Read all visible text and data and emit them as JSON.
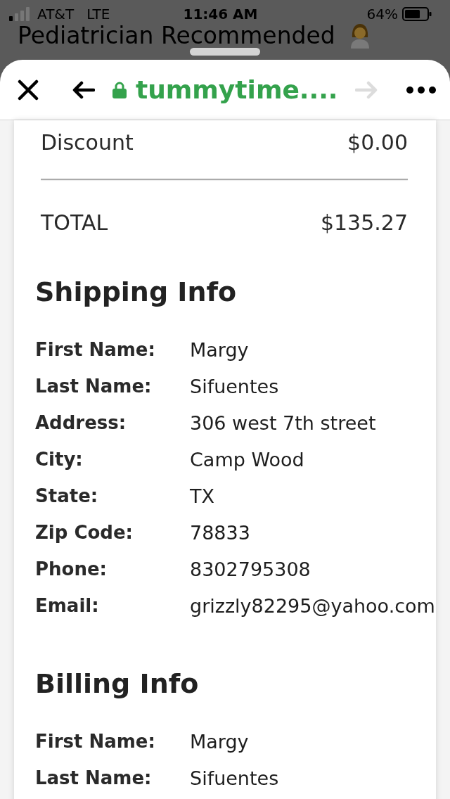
{
  "status_bar": {
    "carrier": "AT&T",
    "network": "LTE",
    "time": "11:46 AM",
    "battery": "64%"
  },
  "background_page": {
    "title": "Pediatrician Recommended"
  },
  "browser_toolbar": {
    "url": "tummytime....",
    "secure": true,
    "forward_disabled": true
  },
  "order_summary": [
    {
      "kind": "line",
      "label": "Discount",
      "amount": "$0.00"
    },
    {
      "kind": "total",
      "label": "TOTAL",
      "amount": "$135.27"
    }
  ],
  "sections": [
    {
      "title": "Shipping Info",
      "fields": [
        {
          "label": "First Name:",
          "value": "Margy"
        },
        {
          "label": "Last Name:",
          "value": "Sifuentes"
        },
        {
          "label": "Address:",
          "value": "306 west 7th street"
        },
        {
          "label": "City:",
          "value": "Camp Wood"
        },
        {
          "label": "State:",
          "value": "TX"
        },
        {
          "label": "Zip Code:",
          "value": "78833"
        },
        {
          "label": "Phone:",
          "value": "8302795308"
        },
        {
          "label": "Email:",
          "value": "grizzly82295@yahoo.com"
        }
      ]
    },
    {
      "title": "Billing Info",
      "fields": [
        {
          "label": "First Name:",
          "value": "Margy"
        },
        {
          "label": "Last Name:",
          "value": "Sifuentes"
        }
      ]
    }
  ]
}
